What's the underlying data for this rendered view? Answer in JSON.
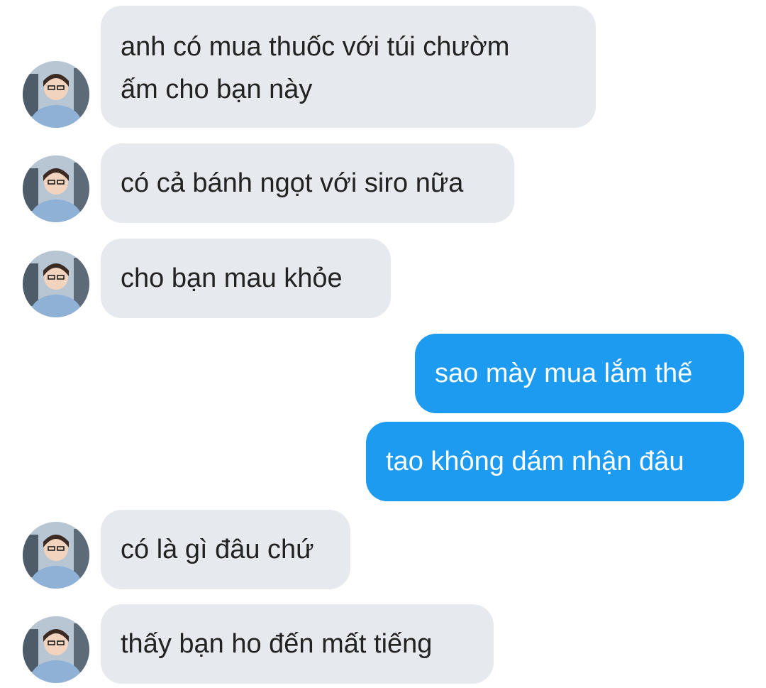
{
  "conversation": {
    "messages": [
      {
        "sender": "other",
        "text": "anh có mua thuốc với túi chườm\nấm cho bạn này"
      },
      {
        "sender": "other",
        "text": "có cả bánh ngọt với siro nữa"
      },
      {
        "sender": "other",
        "text": "cho bạn mau khỏe"
      },
      {
        "sender": "me",
        "text": "sao mày mua lắm thế"
      },
      {
        "sender": "me",
        "text": "tao không dám nhận đâu"
      },
      {
        "sender": "other",
        "text": "có là gì đâu chứ"
      },
      {
        "sender": "other",
        "text": "thấy bạn ho đến mất tiếng"
      }
    ]
  },
  "theme": {
    "incoming_bubble": "#e6e9ed",
    "outgoing_bubble": "#1d9bf0",
    "incoming_text": "#222222",
    "outgoing_text": "#ffffff"
  },
  "avatar": {
    "icon": "contact-avatar-photo"
  }
}
